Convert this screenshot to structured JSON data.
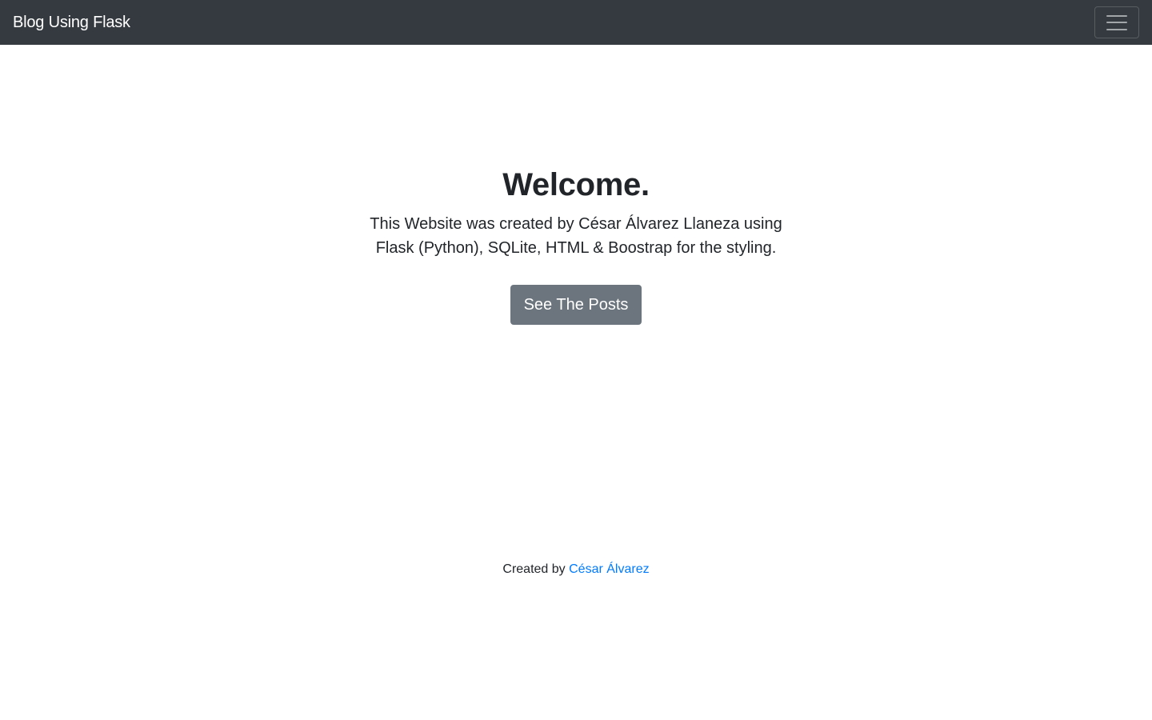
{
  "navbar": {
    "brand": "Blog Using Flask",
    "toggler_icon": "hamburger-menu-icon"
  },
  "hero": {
    "title": "Welcome.",
    "description": "This Website was created by César Álvarez Llaneza using Flask (Python), SQLite, HTML & Boostrap for the styling.",
    "button_label": "See The Posts"
  },
  "footer": {
    "prefix": "Created by",
    "author_link": "César Álvarez"
  },
  "colors": {
    "navbar_bg": "#343a40",
    "button_bg": "#6c757d",
    "link": "#007bff"
  }
}
